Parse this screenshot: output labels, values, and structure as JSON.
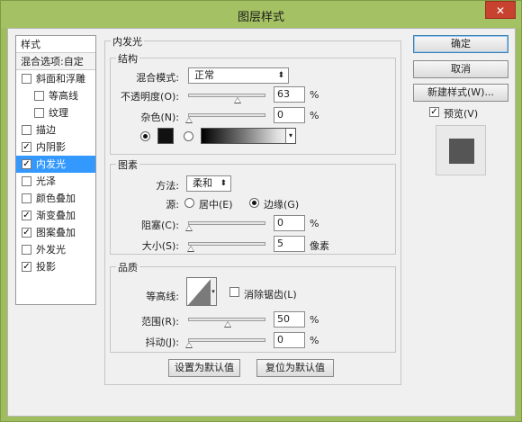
{
  "window": {
    "title": "图层样式",
    "close": "✕"
  },
  "stylelist": {
    "header": "样式",
    "blend": "混合选项:自定",
    "items": [
      {
        "label": "斜面和浮雕",
        "checked": false,
        "sub": false
      },
      {
        "label": "等高线",
        "checked": false,
        "sub": true
      },
      {
        "label": "纹理",
        "checked": false,
        "sub": true
      },
      {
        "label": "描边",
        "checked": false,
        "sub": false
      },
      {
        "label": "内阴影",
        "checked": true,
        "sub": false
      },
      {
        "label": "内发光",
        "checked": true,
        "sub": false,
        "selected": true
      },
      {
        "label": "光泽",
        "checked": false,
        "sub": false
      },
      {
        "label": "颜色叠加",
        "checked": false,
        "sub": false
      },
      {
        "label": "渐变叠加",
        "checked": true,
        "sub": false
      },
      {
        "label": "图案叠加",
        "checked": true,
        "sub": false
      },
      {
        "label": "外发光",
        "checked": false,
        "sub": false
      },
      {
        "label": "投影",
        "checked": true,
        "sub": false
      }
    ]
  },
  "panel": {
    "title": "内发光",
    "structure": {
      "legend": "结构",
      "blend_mode_label": "混合模式:",
      "blend_mode_value": "正常",
      "opacity_label": "不透明度(O):",
      "opacity_value": "63",
      "noise_label": "杂色(N):",
      "noise_value": "0",
      "unit": "%"
    },
    "elements": {
      "legend": "图素",
      "method_label": "方法:",
      "method_value": "柔和",
      "source_label": "源:",
      "source_center": "居中(E)",
      "source_edge": "边缘(G)",
      "choke_label": "阻塞(C):",
      "choke_value": "0",
      "size_label": "大小(S):",
      "size_value": "5",
      "size_unit": "像素",
      "unit": "%"
    },
    "quality": {
      "legend": "品质",
      "contour_label": "等高线:",
      "antialias_label": "消除锯齿(L)",
      "range_label": "范围(R):",
      "range_value": "50",
      "jitter_label": "抖动(J):",
      "jitter_value": "0",
      "unit": "%"
    },
    "make_default": "设置为默认值",
    "reset_default": "复位为默认值"
  },
  "buttons": {
    "ok": "确定",
    "cancel": "取消",
    "new_style": "新建样式(W)...",
    "preview": "预览(V)"
  },
  "colors": {
    "accent": "#3399ff",
    "glow_color": "#111111",
    "preview_swatch": "#555555"
  }
}
